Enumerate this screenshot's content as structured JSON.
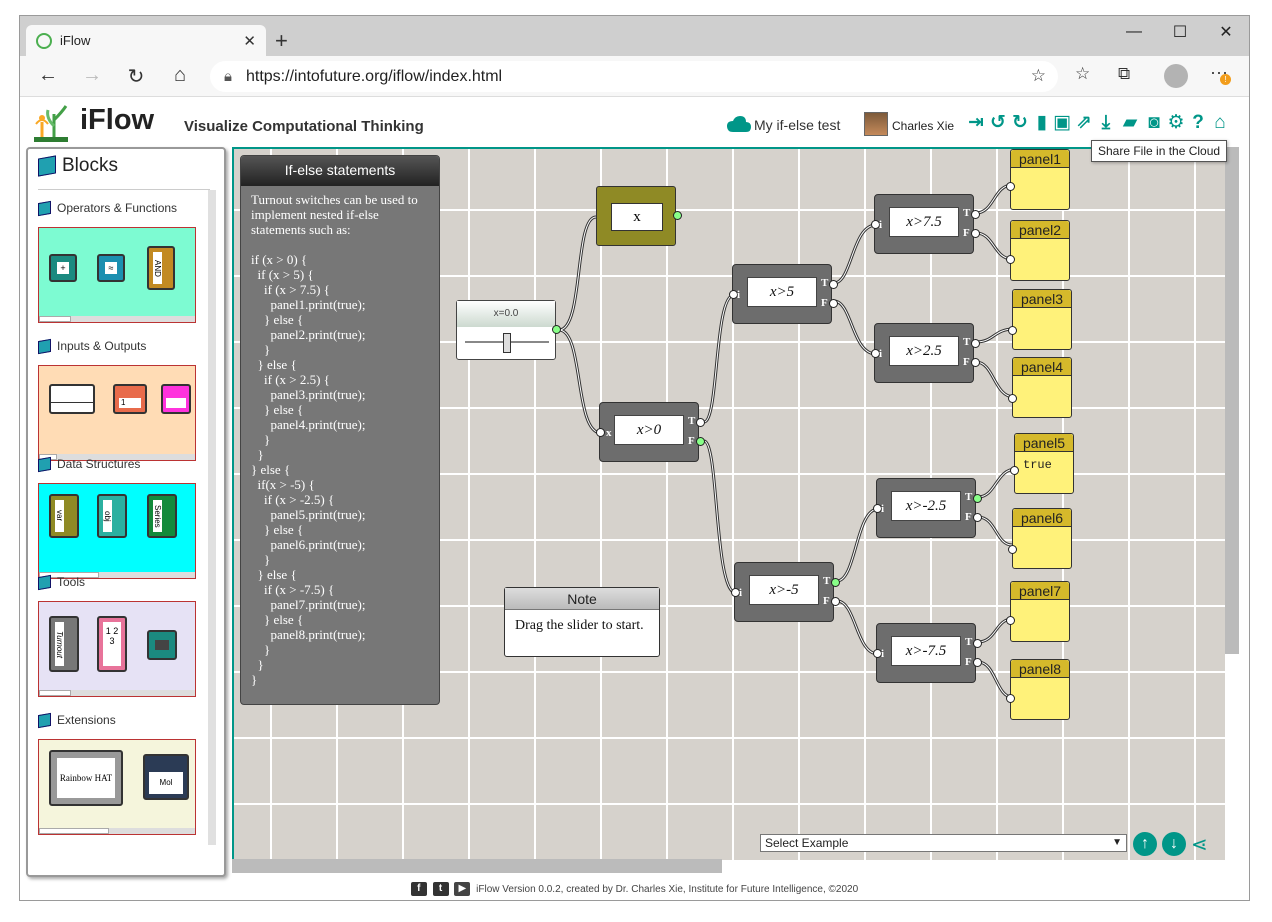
{
  "browser": {
    "tab_title": "iFlow",
    "tab_close": "✕",
    "new_tab": "+",
    "window_buttons": [
      "—",
      "☐",
      "✕"
    ],
    "url": "https://intofuture.org/iflow/index.html"
  },
  "app": {
    "title": "iFlow",
    "subtitle": "Visualize Computational Thinking",
    "project_name": "My if-else test",
    "user_name": "Charles Xie",
    "tooltip": "Share File in the Cloud",
    "accent": "#009688"
  },
  "palette": {
    "title": "Blocks",
    "categories": [
      {
        "label": "Operators & Functions",
        "bg": "#7dfbd2",
        "items": [
          "+",
          "≈",
          "AND"
        ]
      },
      {
        "label": "Inputs & Outputs",
        "bg": "#ffdcb5",
        "items": [
          "",
          "1",
          ""
        ]
      },
      {
        "label": "Data Structures",
        "bg": "#00ffff",
        "items": [
          "var",
          "obj",
          "Series"
        ]
      },
      {
        "label": "Tools",
        "bg": "#e6e2f5",
        "items": [
          "Turnout",
          "1 2 3",
          ""
        ]
      },
      {
        "label": "Extensions",
        "bg": "#f5f5dc",
        "items": [
          "Rainbow HAT",
          "Mol"
        ]
      }
    ]
  },
  "canvas": {
    "info_title": "If-else statements",
    "info_body": "Turnout switches can be used to\nimplement nested if-else\nstatements such as:\n\nif (x > 0) {\n  if (x > 5) {\n    if (x > 7.5) {\n      panel1.print(true);\n    } else {\n      panel2.print(true);\n    }\n  } else {\n    if (x > 2.5) {\n      panel3.print(true);\n    } else {\n      panel4.print(true);\n    }\n  }\n} else {\n  if(x > -5) {\n    if (x > -2.5) {\n      panel5.print(true);\n    } else {\n      panel6.print(true);\n    }\n  } else {\n    if (x > -7.5) {\n      panel7.print(true);\n    } else {\n      panel8.print(true);\n    }\n  }\n}",
    "slider_label": "x=0.0",
    "x_block": "x",
    "note_title": "Note",
    "note_text": "Drag the slider to start.",
    "switches": [
      "x>0",
      "x>5",
      "x>-5",
      "x>7.5",
      "x>2.5",
      "x>-2.5",
      "x>-7.5"
    ],
    "port_i": "i",
    "port_x": "x",
    "port_t": "T",
    "port_f": "F",
    "panels": [
      {
        "name": "panel1",
        "value": ""
      },
      {
        "name": "panel2",
        "value": ""
      },
      {
        "name": "panel3",
        "value": ""
      },
      {
        "name": "panel4",
        "value": ""
      },
      {
        "name": "panel5",
        "value": "true"
      },
      {
        "name": "panel6",
        "value": ""
      },
      {
        "name": "panel7",
        "value": ""
      },
      {
        "name": "panel8",
        "value": ""
      }
    ],
    "select_example": "Select Example"
  },
  "footer": {
    "text": "iFlow Version 0.0.2, created by Dr. Charles Xie, Institute for Future Intelligence, ©2020"
  }
}
